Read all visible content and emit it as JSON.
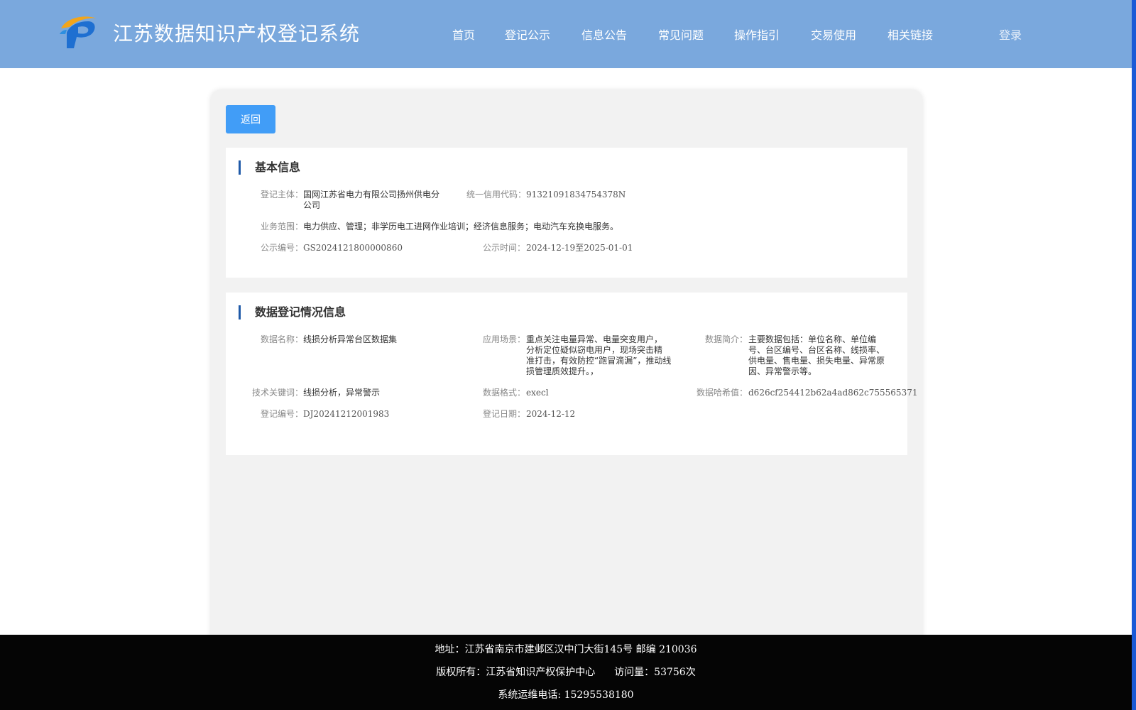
{
  "header": {
    "title": "江苏数据知识产权登记系统",
    "logo_icon": "jiangsu-ip-logo",
    "nav": [
      "首页",
      "登记公示",
      "信息公告",
      "常见问题",
      "操作指引",
      "交易使用",
      "相关链接"
    ],
    "login_label": "登录"
  },
  "actions": {
    "back_label": "返回"
  },
  "basic_info": {
    "title": "基本信息",
    "subject_label": "登记主体：",
    "subject_line1": "国网江苏省电力有限公司扬州供电分",
    "subject_line2": "公司",
    "credit_code_label": "统一信用代码：",
    "credit_code": "91321091834754378N",
    "scope_label": "业务范围：",
    "scope": "电力供应、管理；非学历电工进网作业培训；经济信息服务；电动汽车充换电服务。",
    "notice_no_label": "公示编号：",
    "notice_no": "GS2024121800000860",
    "notice_time_label": "公示时间：",
    "notice_time": "2024-12-19至2025-01-01"
  },
  "data_info": {
    "title": "数据登记情况信息",
    "name_label": "数据名称：",
    "name": "线损分析异常台区数据集",
    "scenario_label": "应用场景：",
    "scenario_lines": [
      "重点关注电量异常、电量突变用户，",
      "分析定位疑似窃电用户，现场突击精",
      "准打击，有效防控“跑冒滴漏”，推动线",
      "损管理质效提升。，"
    ],
    "intro_label": "数据简介：",
    "intro_lines": [
      "主要数据包括：单位名称、单位编",
      "号、台区编号、台区名称、线损率、",
      "供电量、售电量、损失电量、异常原",
      "因、异常警示等。"
    ],
    "keywords_label": "技术关键词：",
    "keywords": "线损分析，异常警示",
    "format_label": "数据格式：",
    "format": "execl",
    "hash_label": "数据哈希值：",
    "hash": "d626cf254412b62a4ad862c755565371",
    "reg_no_label": "登记编号：",
    "reg_no": "DJ20241212001983",
    "reg_date_label": "登记日期：",
    "reg_date": "2024-12-12"
  },
  "footer": {
    "address": "地址：江苏省南京市建邺区汉中门大街145号 邮编 210036",
    "copyright": "版权所有：江苏省知识产权保护中心",
    "visits": "访问量：53756次",
    "phone": "系统运维电话: 15295538180"
  }
}
